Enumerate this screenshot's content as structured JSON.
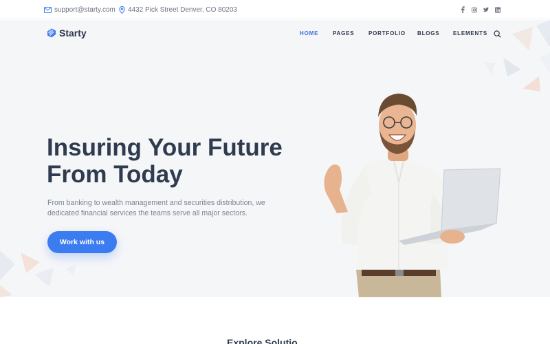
{
  "topbar": {
    "email": "support@starty.com",
    "address": "4432 Pick Street Denver, CO 80203",
    "socials": [
      "facebook-icon",
      "instagram-icon",
      "twitter-icon",
      "linkedin-icon"
    ]
  },
  "brand": {
    "name": "Starty"
  },
  "nav": {
    "items": [
      "HOME",
      "PAGES",
      "PORTFOLIO",
      "BLOGS",
      "ELEMENTS"
    ],
    "active": "HOME"
  },
  "hero": {
    "headline_line1": "Insuring Your Future",
    "headline_line2": "From Today",
    "subtext": "From banking to wealth management and securities distribution, we dedicated financial services the teams serve all major sectors.",
    "cta_label": "Work with us"
  },
  "next_section": {
    "title_partial": "Explore Solutio"
  },
  "colors": {
    "accent": "#3b7cf0",
    "nav_active": "#3b6fe0",
    "headline": "#2f3b4e",
    "hero_bg": "#f5f6f8"
  }
}
